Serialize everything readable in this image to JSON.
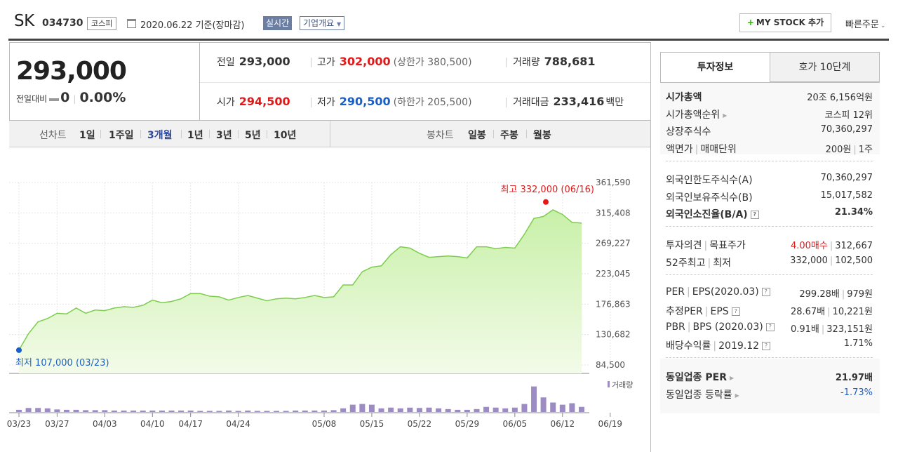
{
  "header": {
    "stock_name": "SK",
    "stock_code": "034730",
    "market": "코스피",
    "date_label": "2020.06.22 기준(장마감)",
    "live_label": "실시간",
    "corp_label": "기업개요",
    "mystock_label": "MY STOCK 추가",
    "quick_order_label": "빠른주문"
  },
  "price": {
    "current": "293,000",
    "change_label": "전일대비",
    "change_value": "0",
    "change_rate": "0.00%"
  },
  "quote": {
    "prev_close_label": "전일",
    "prev_close": "293,000",
    "high_label": "고가",
    "high": "302,000",
    "upper_limit": "(상한가 380,500)",
    "volume_label": "거래량",
    "volume": "788,681",
    "open_label": "시가",
    "open": "294,500",
    "low_label": "저가",
    "low": "290,500",
    "lower_limit": "(하한가 205,500)",
    "amount_label": "거래대금",
    "amount": "233,416",
    "amount_unit": "백만"
  },
  "periods": {
    "line_label": "선차트",
    "items": [
      "1일",
      "1주일",
      "3개월",
      "1년",
      "3년",
      "5년",
      "10년"
    ],
    "active": "3개월",
    "candle_label": "봉차트",
    "candle_items": [
      "일봉",
      "주봉",
      "월봉"
    ]
  },
  "colors": {
    "up": "#e01919",
    "down": "#1a5fc7",
    "area_fill": "#c8f0a8",
    "area_line": "#7ccd4c",
    "volume_bar": "#9d8cc3"
  },
  "chart_data": {
    "type": "area",
    "y_ticks": [
      "361,590",
      "315,408",
      "269,227",
      "223,045",
      "176,863",
      "130,682",
      "84,500"
    ],
    "ylim": [
      84500,
      361590
    ],
    "x_tick_labels": [
      "03/23",
      "03/27",
      "04/03",
      "04/10",
      "04/17",
      "04/24",
      "05/08",
      "05/15",
      "05/22",
      "05/29",
      "06/05",
      "06/12",
      "06/19"
    ],
    "high_annotation": "최고 332,000 (06/16)",
    "low_annotation": "최저 107,000 (03/23)",
    "high_value": 332000,
    "low_value": 107000,
    "volume_legend": "거래량",
    "x_index_ticks": [
      0,
      4,
      9,
      14,
      18,
      23,
      32,
      37,
      42,
      47,
      52,
      57,
      62
    ],
    "series": [
      {
        "values": [
          107000,
          132000,
          150000,
          155000,
          163000,
          162000,
          171000,
          163000,
          168000,
          167000,
          171000,
          173000,
          172000,
          175000,
          183000,
          179000,
          181000,
          185000,
          193000,
          193000,
          189000,
          188000,
          183000,
          187000,
          190000,
          186000,
          182000,
          185000,
          186000,
          185000,
          187000,
          190000,
          187000,
          188000,
          206000,
          206000,
          226000,
          233000,
          235000,
          252000,
          264000,
          262000,
          254000,
          248000,
          249000,
          250000,
          249000,
          247000,
          264000,
          264000,
          261000,
          263000,
          262000,
          283000,
          307000,
          310000,
          320000,
          313000,
          301000,
          300000
        ]
      },
      {
        "name": "거래량",
        "values": [
          0.06,
          0.11,
          0.11,
          0.1,
          0.07,
          0.06,
          0.06,
          0.05,
          0.05,
          0.05,
          0.04,
          0.04,
          0.04,
          0.04,
          0.04,
          0.04,
          0.04,
          0.04,
          0.04,
          0.03,
          0.03,
          0.03,
          0.04,
          0.03,
          0.04,
          0.03,
          0.03,
          0.03,
          0.03,
          0.04,
          0.04,
          0.04,
          0.04,
          0.05,
          0.1,
          0.2,
          0.22,
          0.2,
          0.1,
          0.12,
          0.1,
          0.12,
          0.11,
          0.12,
          0.1,
          0.08,
          0.06,
          0.06,
          0.08,
          0.14,
          0.12,
          0.1,
          0.12,
          0.22,
          0.7,
          0.4,
          0.26,
          0.2,
          0.24,
          0.14
        ]
      }
    ]
  },
  "right_panel": {
    "tabs": [
      "투자정보",
      "호가 10단계"
    ],
    "rows": [
      {
        "k": "시가총액",
        "v": "20조 6,156억원",
        "bold_key": true
      },
      {
        "k": "시가총액순위",
        "v": "코스피 12위",
        "arrow": true
      },
      {
        "k": "상장주식수",
        "v": "70,360,297"
      },
      {
        "k": "액면가",
        "k2": "매매단위",
        "v": "200원",
        "v2": "1주"
      },
      {
        "k": "외국인한도주식수(A)",
        "v": "70,360,297"
      },
      {
        "k": "외국인보유주식수(B)",
        "v": "15,017,582"
      },
      {
        "k": "외국인소진율(B/A)",
        "v": "21.34%",
        "help": true,
        "bold": true
      },
      {
        "k": "투자의견",
        "k2": "목표주가",
        "v": "4.00매수",
        "v2": "312,667",
        "v_red": true
      },
      {
        "k": "52주최고",
        "k2": "최저",
        "v": "332,000",
        "v2": "102,500"
      },
      {
        "k": "PER",
        "k2": "EPS(2020.03)",
        "v": "299.28배",
        "v2": "979원",
        "help": true
      },
      {
        "k": "추정PER",
        "k2": "EPS",
        "v": "28.67배",
        "v2": "10,221원",
        "help": true
      },
      {
        "k": "PBR",
        "k2": "BPS (2020.03)",
        "v": "0.91배",
        "v2": "323,151원",
        "help": true
      },
      {
        "k": "배당수익률",
        "k2": "2019.12",
        "v": "1.71%",
        "help": true
      },
      {
        "k": "동일업종 PER",
        "v": "21.97배",
        "arrow": true,
        "bold": true
      },
      {
        "k": "동일업종 등락률",
        "v": "-1.73%",
        "arrow": true,
        "v_blue": true
      }
    ]
  }
}
